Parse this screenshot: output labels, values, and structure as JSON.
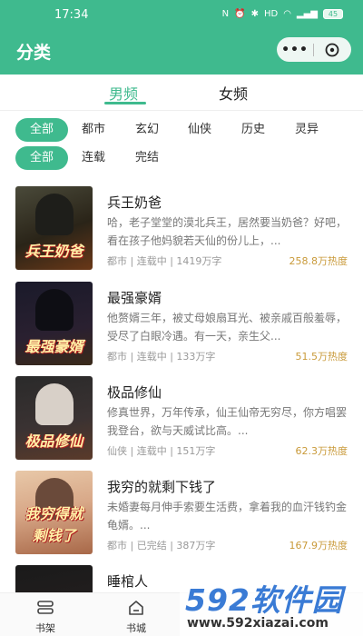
{
  "status_bar": {
    "time": "17:34",
    "icons": [
      "nfc-icon",
      "alarm-icon",
      "bluetooth-icon",
      "hd-icon",
      "wifi-icon",
      "signal-icon"
    ],
    "battery": "45"
  },
  "app_bar": {
    "title": "分类",
    "menu": "•••"
  },
  "gender_tabs": [
    {
      "label": "男频",
      "active": true
    },
    {
      "label": "女频",
      "active": false
    }
  ],
  "category_filters": [
    "全部",
    "都市",
    "玄幻",
    "仙侠",
    "历史",
    "灵异"
  ],
  "status_filters": [
    "全部",
    "连载",
    "完结"
  ],
  "books": [
    {
      "title": "兵王奶爸",
      "desc": "哈，老子堂堂的漠北兵王，居然要当奶爸？好吧，看在孩子他妈貌若天仙的份儿上，...",
      "meta": "都市 | 连载中 | 1419万字",
      "heat": "258.8万热度",
      "cover_text": "兵王奶爸"
    },
    {
      "title": "最强豪婿",
      "desc": "他赘婿三年，被丈母娘扇耳光、被亲戚百般羞辱，受尽了白眼冷遇。有一天，亲生父...",
      "meta": "都市 | 连载中 | 133万字",
      "heat": "51.5万热度",
      "cover_text": "最强豪婿"
    },
    {
      "title": "极品修仙",
      "desc": "修真世界，万年传承，仙王仙帝无穷尽，你方唱罢我登台，欲与天威试比高。...",
      "meta": "仙侠 | 连载中 | 151万字",
      "heat": "62.3万热度",
      "cover_text": "极品修仙"
    },
    {
      "title": "我穷的就剩下钱了",
      "desc": "未婚妻每月伸手索要生活费，拿着我的血汗钱钓金龟婿。...",
      "meta": "都市 | 已完结 | 387万字",
      "heat": "167.9万热度",
      "cover_text": "我穷得就剩钱了"
    },
    {
      "title": "睡棺人",
      "desc": "",
      "meta": "",
      "heat": "",
      "cover_text": ""
    }
  ],
  "bottom_nav": [
    {
      "label": "书架",
      "icon": "bookshelf-icon"
    },
    {
      "label": "书城",
      "icon": "bookstore-icon"
    }
  ],
  "watermark": {
    "logo": "592软件园",
    "url": "www.592xiazai.com"
  },
  "colors": {
    "primary": "#3fba8e",
    "heat": "#c99a3a"
  }
}
